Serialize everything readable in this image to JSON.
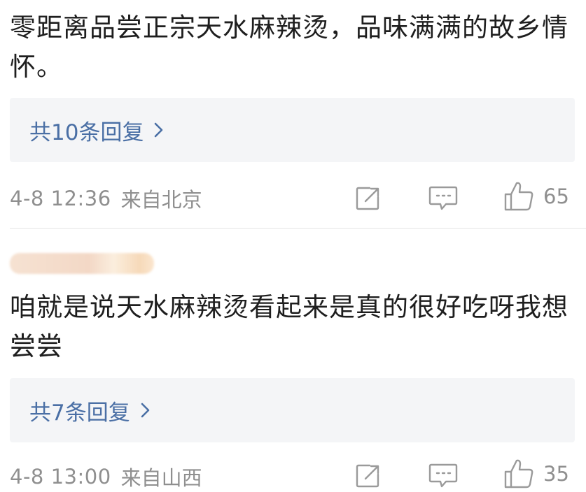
{
  "comments": [
    {
      "text": "零距离品尝正宗天水麻辣烫，品味满满的故乡情怀。",
      "replies_label": "共10条回复",
      "time": "4-8 12:36",
      "location": "来自北京",
      "like_count": "65"
    },
    {
      "user_name": "",
      "text": "咱就是说天水麻辣烫看起来是真的很好吃呀我想尝尝",
      "replies_label": "共7条回复",
      "time": "4-8 13:00",
      "location": "来自山西",
      "like_count": "35"
    }
  ],
  "icons": {
    "share": "share-icon",
    "comment": "comment-icon",
    "like": "thumbs-up-icon",
    "chevron": "chevron-right-icon"
  },
  "colors": {
    "link": "#4a6fa5",
    "meta": "#8f8f8f",
    "reply_box_bg": "#f4f5f7"
  }
}
